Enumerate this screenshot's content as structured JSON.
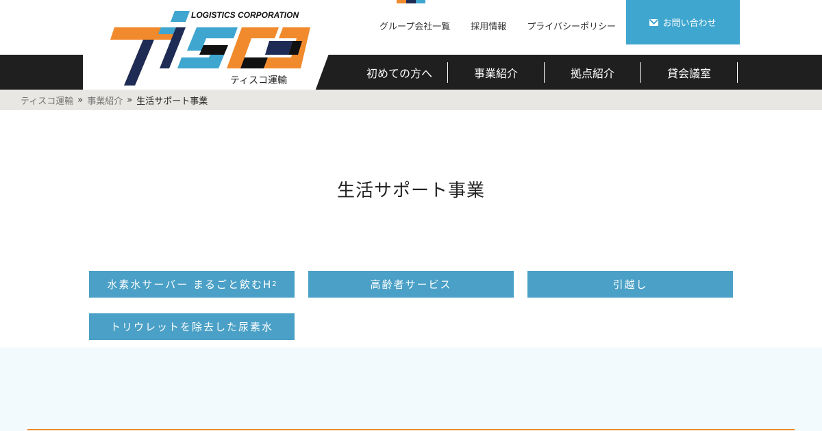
{
  "colors": {
    "accent_blue": "#3ea6cf",
    "service_blue": "#4aa0c6",
    "nav_dark": "#1f1f1f",
    "breadcrumb_bg": "#e9e7e3",
    "lower_band": "#f3fafd",
    "orange": "#f08a2c",
    "navy": "#1d2b55"
  },
  "header": {
    "logo_top_text": "LOGISTICS CORPORATION",
    "logo_main_text": "TISCO",
    "logo_sub_text": "ティスコ運輸",
    "util_links": [
      {
        "label": "グループ会社一覧"
      },
      {
        "label": "採用情報"
      },
      {
        "label": "プライバシーポリシー"
      }
    ],
    "contact_label": "お問い合わせ"
  },
  "main_nav": [
    {
      "label": "初めての方へ"
    },
    {
      "label": "事業紹介"
    },
    {
      "label": "拠点紹介"
    },
    {
      "label": "貸会議室"
    }
  ],
  "breadcrumb": {
    "items": [
      "ティスコ運輸",
      "事業紹介"
    ],
    "separator": "»",
    "current": "生活サポート事業"
  },
  "page_title": "生活サポート事業",
  "services": [
    {
      "label": "水素水サーバー まるごと飲むH",
      "sub": "2"
    },
    {
      "label": "高齢者サービス",
      "sub": ""
    },
    {
      "label": "引越し",
      "sub": ""
    },
    {
      "label": "トリウレットを除去した尿素水",
      "sub": ""
    }
  ]
}
